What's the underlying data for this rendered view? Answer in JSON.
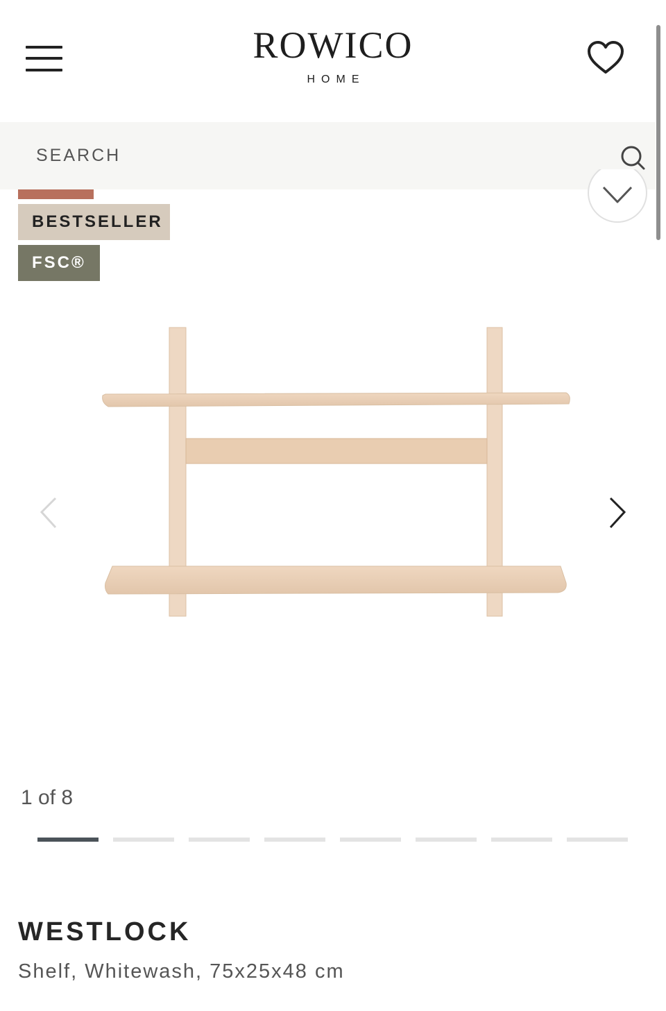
{
  "header": {
    "logo_main": "ROWICO",
    "logo_sub": "HOME"
  },
  "search": {
    "placeholder": "SEARCH"
  },
  "badges": {
    "bestseller": "BESTSELLER",
    "fsc": "FSC®"
  },
  "gallery": {
    "counter": "1 of 8",
    "total": 8,
    "current": 1
  },
  "product": {
    "name": "WESTLOCK",
    "description": "Shelf, Whitewash, 75x25x48 cm"
  },
  "colors": {
    "badge_red": "#b8705d",
    "badge_bestseller": "#d6cbbd",
    "badge_fsc": "#767765",
    "dot_active": "#4b5359",
    "dot_inactive": "#e3e3e3"
  },
  "icons": [
    "menu-icon",
    "heart-icon",
    "search-icon",
    "chevron-left-icon",
    "chevron-right-icon",
    "chevron-down-icon"
  ]
}
